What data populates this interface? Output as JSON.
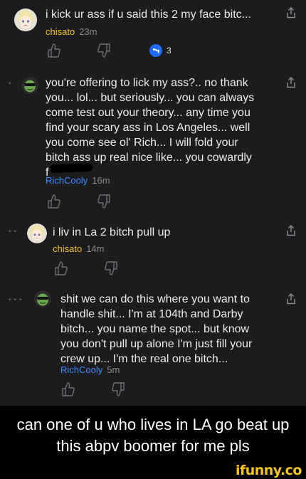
{
  "comments": [
    {
      "text": "i kick ur ass if u said this 2 my face bitc...",
      "username": "chisato",
      "time": "23m",
      "reply_count": "3",
      "avatar": "anime-girl-avatar"
    },
    {
      "text_lines": [
        "you're offering to lick my ass?.. no thank",
        "you... lol... but seriously... you can always",
        "come test out your theory... any time you",
        "find your scary ass in Los Angeles... well",
        "you come see ol' Rich... I will fold your",
        "bitch ass up real nice like... you cowardly",
        "f"
      ],
      "username": "RichCooly",
      "time": "16m",
      "avatar": "green-character-avatar"
    },
    {
      "text": "i liv in La 2 bitch pull up",
      "username": "chisato",
      "time": "14m",
      "avatar": "anime-girl-avatar"
    },
    {
      "text_lines": [
        "shit we can do this where you want to",
        "handle shit... I'm at 104th and Darby",
        "bitch... you name the spot... but know",
        "you don't pull up alone I'm just fill your",
        "crew up... I'm the real one bitch..."
      ],
      "username": "RichCooly",
      "time": "5m",
      "avatar": "green-character-avatar"
    }
  ],
  "caption": "can one of u who lives in LA go beat up this abpv boomer for me pls",
  "watermark": "ifunny.co",
  "colors": {
    "background": "#1c1c1e",
    "username_yellow": "#f5c518",
    "username_blue": "#3d8bfd",
    "reply_badge": "#1e6bff"
  }
}
